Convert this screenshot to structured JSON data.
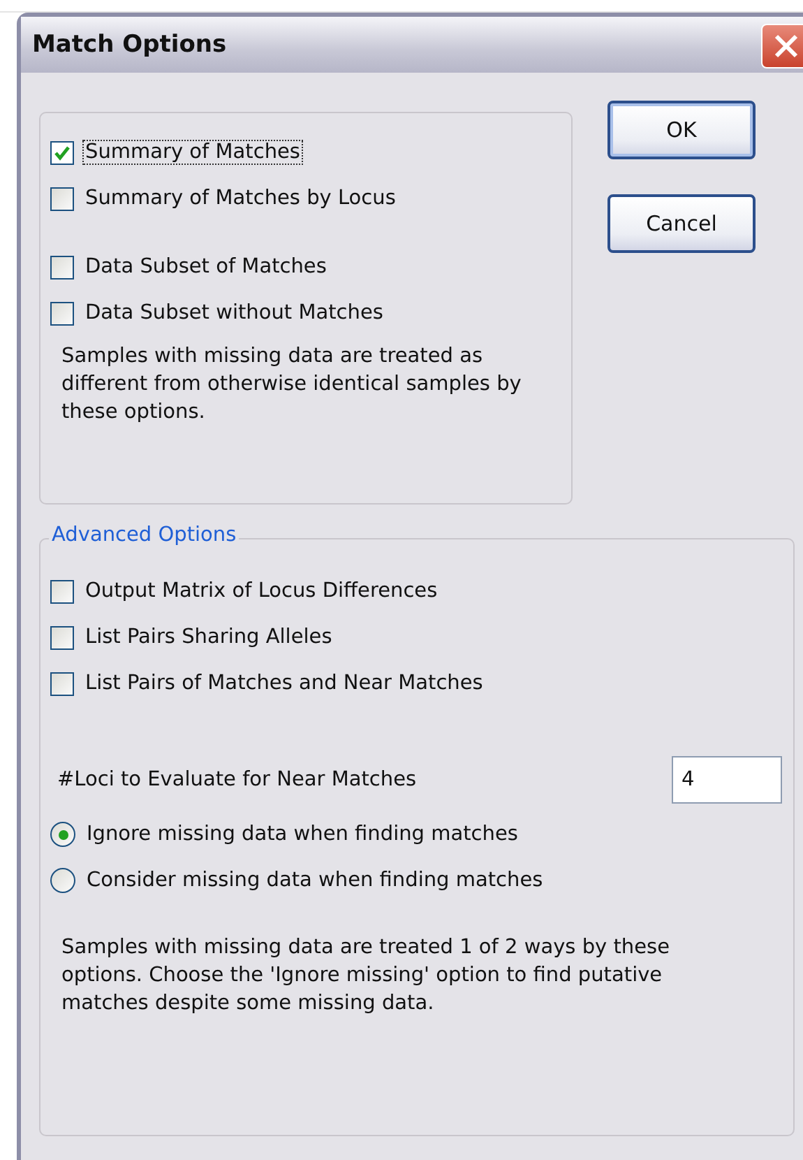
{
  "window": {
    "title": "Match Options"
  },
  "output_group": {
    "summaries": [
      {
        "label": "Summary of Matches",
        "checked": true,
        "focused": true
      },
      {
        "label": "Summary of Matches by Locus",
        "checked": false,
        "focused": false
      }
    ],
    "subsets": [
      {
        "label": "Data Subset of Matches",
        "checked": false,
        "focused": false
      },
      {
        "label": "Data Subset without Matches",
        "checked": false,
        "focused": false
      }
    ],
    "note": "Samples with missing data are treated as different from otherwise identical samples by these options."
  },
  "buttons": [
    {
      "label": "OK",
      "default": true
    },
    {
      "label": "Cancel",
      "default": false
    }
  ],
  "advanced": {
    "title": "Advanced Options",
    "items": [
      {
        "label": "Output Matrix of Locus Differences",
        "checked": false
      },
      {
        "label": "List Pairs Sharing Alleles",
        "checked": false
      },
      {
        "label": "List Pairs of Matches and Near Matches",
        "checked": false
      }
    ],
    "loci": {
      "label": "#Loci to Evaluate for Near Matches",
      "value": "4"
    },
    "radios": [
      {
        "label": "Ignore missing data when finding matches",
        "selected": true
      },
      {
        "label": "Consider missing data when finding matches",
        "selected": false
      }
    ],
    "note": "Samples with missing data are treated 1 of 2 ways by these options. Choose the 'Ignore missing' option to find putative matches despite some missing data."
  }
}
